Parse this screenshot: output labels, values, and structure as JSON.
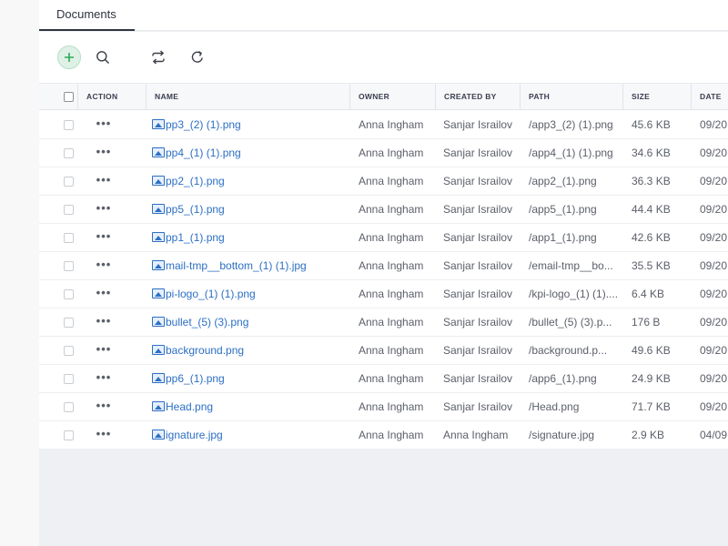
{
  "tab": {
    "label": "Documents"
  },
  "toolbar": {
    "add_icon": "plus-icon",
    "search_icon": "search-icon",
    "sync_icon": "sync-icon",
    "refresh_icon": "refresh-icon",
    "accent_color": "#2eaa5a"
  },
  "columns": {
    "action": "ACTION",
    "name": "NAME",
    "owner": "OWNER",
    "created_by": "CREATED BY",
    "path": "PATH",
    "size": "SIZE",
    "date": "DATE"
  },
  "rows": [
    {
      "name": "pp3_(2) (1).png",
      "owner": "Anna Ingham",
      "created_by": "Sanjar Israilov",
      "path": "/app3_(2) (1).png",
      "size": "45.6 KB",
      "date": "09/20"
    },
    {
      "name": "pp4_(1) (1).png",
      "owner": "Anna Ingham",
      "created_by": "Sanjar Israilov",
      "path": "/app4_(1) (1).png",
      "size": "34.6 KB",
      "date": "09/20"
    },
    {
      "name": "pp2_(1).png",
      "owner": "Anna Ingham",
      "created_by": "Sanjar Israilov",
      "path": "/app2_(1).png",
      "size": "36.3 KB",
      "date": "09/20"
    },
    {
      "name": "pp5_(1).png",
      "owner": "Anna Ingham",
      "created_by": "Sanjar Israilov",
      "path": "/app5_(1).png",
      "size": "44.4 KB",
      "date": "09/20"
    },
    {
      "name": "pp1_(1).png",
      "owner": "Anna Ingham",
      "created_by": "Sanjar Israilov",
      "path": "/app1_(1).png",
      "size": "42.6 KB",
      "date": "09/20"
    },
    {
      "name": "mail-tmp__bottom_(1) (1).jpg",
      "owner": "Anna Ingham",
      "created_by": "Sanjar Israilov",
      "path": "/email-tmp__bo...",
      "size": "35.5 KB",
      "date": "09/20"
    },
    {
      "name": "pi-logo_(1) (1).png",
      "owner": "Anna Ingham",
      "created_by": "Sanjar Israilov",
      "path": "/kpi-logo_(1) (1)....",
      "size": "6.4 KB",
      "date": "09/20"
    },
    {
      "name": "bullet_(5) (3).png",
      "owner": "Anna Ingham",
      "created_by": "Sanjar Israilov",
      "path": "/bullet_(5) (3).p...",
      "size": "176 B",
      "date": "09/20"
    },
    {
      "name": "background.png",
      "owner": "Anna Ingham",
      "created_by": "Sanjar Israilov",
      "path": "/background.p...",
      "size": "49.6 KB",
      "date": "09/20"
    },
    {
      "name": "pp6_(1).png",
      "owner": "Anna Ingham",
      "created_by": "Sanjar Israilov",
      "path": "/app6_(1).png",
      "size": "24.9 KB",
      "date": "09/20"
    },
    {
      "name": "Head.png",
      "owner": "Anna Ingham",
      "created_by": "Sanjar Israilov",
      "path": "/Head.png",
      "size": "71.7 KB",
      "date": "09/20"
    },
    {
      "name": "ignature.jpg",
      "owner": "Anna Ingham",
      "created_by": "Anna Ingham",
      "path": "/signature.jpg",
      "size": "2.9 KB",
      "date": "04/09"
    }
  ]
}
